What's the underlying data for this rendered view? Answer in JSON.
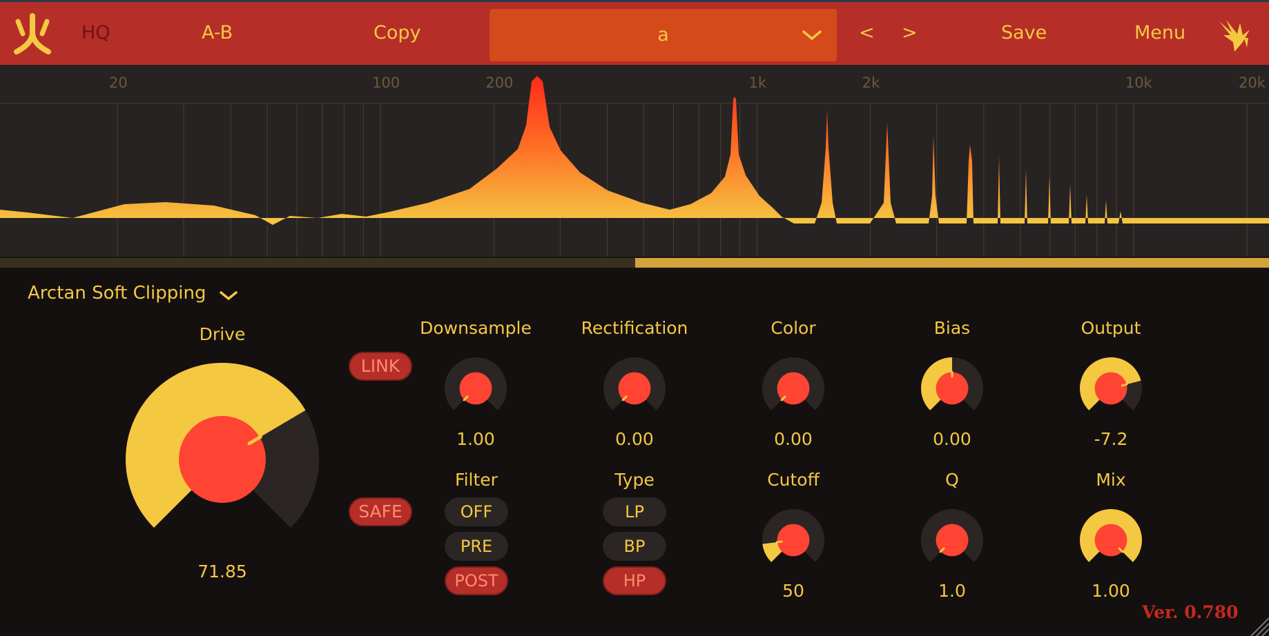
{
  "topbar": {
    "hq_label": "HQ",
    "ab_label": "A-B",
    "copy_label": "Copy",
    "preset_name": "a",
    "prev_label": "<",
    "next_label": ">",
    "save_label": "Save",
    "menu_label": "Menu",
    "logo_icon": "fire-glyph-icon",
    "brand_icon": "bird-logo-icon"
  },
  "spectrum": {
    "freq_labels": [
      "20",
      "100",
      "200",
      "1k",
      "2k",
      "10k",
      "20k"
    ]
  },
  "distortion": {
    "mode_label": "Arctan Soft Clipping",
    "drive": {
      "label": "Drive",
      "value": "71.85",
      "level": 0.72
    }
  },
  "buttons": {
    "link_label": "LINK",
    "safe_label": "SAFE"
  },
  "knobs_row1": [
    {
      "label": "Downsample",
      "value": "1.00",
      "level": 0.0
    },
    {
      "label": "Rectification",
      "value": "0.00",
      "level": 0.0
    },
    {
      "label": "Color",
      "value": "0.00",
      "level": 0.0
    },
    {
      "label": "Bias",
      "value": "0.00",
      "level": 0.5
    },
    {
      "label": "Output",
      "value": "-7.2",
      "level": 0.78
    }
  ],
  "filter": {
    "label": "Filter",
    "options": [
      "OFF",
      "PRE",
      "POST"
    ],
    "selected": "POST"
  },
  "type": {
    "label": "Type",
    "options": [
      "LP",
      "BP",
      "HP"
    ],
    "selected": "HP"
  },
  "knobs_row2": [
    {
      "label": "Cutoff",
      "value": "50",
      "level": 0.14
    },
    {
      "label": "Q",
      "value": "1.0",
      "level": 0.0
    },
    {
      "label": "Mix",
      "value": "1.00",
      "level": 1.0
    }
  ],
  "version": "Ver. 0.780",
  "colors": {
    "topbar": "#b52e28",
    "preset_box": "#d44a1a",
    "accent_yellow": "#f5c842",
    "knob_center": "#ff4433",
    "knob_track": "#2b2624",
    "panel_bg": "#141010"
  }
}
